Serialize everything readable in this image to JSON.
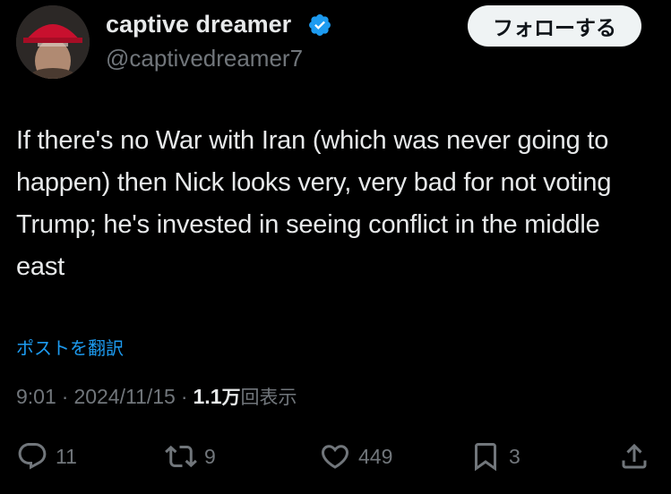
{
  "author": {
    "display_name": "captive dreamer",
    "handle": "@captivedreamer7",
    "verified": true,
    "verified_color": "#1d9bf0"
  },
  "follow_button": {
    "label": "フォローする"
  },
  "post": {
    "text": "If there's no War with Iran (which was never going to happen) then Nick looks very, very bad for not voting Trump; he's invested in seeing conflict in the middle east",
    "translate_label": "ポストを翻訳",
    "time": "9:01",
    "date": "2024/11/15",
    "views_count": "1.1",
    "views_unit": "万",
    "views_label": "回表示"
  },
  "actions": {
    "reply_count": "11",
    "repost_count": "9",
    "like_count": "449",
    "bookmark_count": "3"
  },
  "icons": {
    "reply": "reply-icon",
    "repost": "repost-icon",
    "like": "heart-icon",
    "bookmark": "bookmark-icon",
    "share": "share-icon"
  },
  "colors": {
    "background": "#000000",
    "text": "#e7e9ea",
    "secondary": "#71767b",
    "link": "#1d9bf0"
  }
}
